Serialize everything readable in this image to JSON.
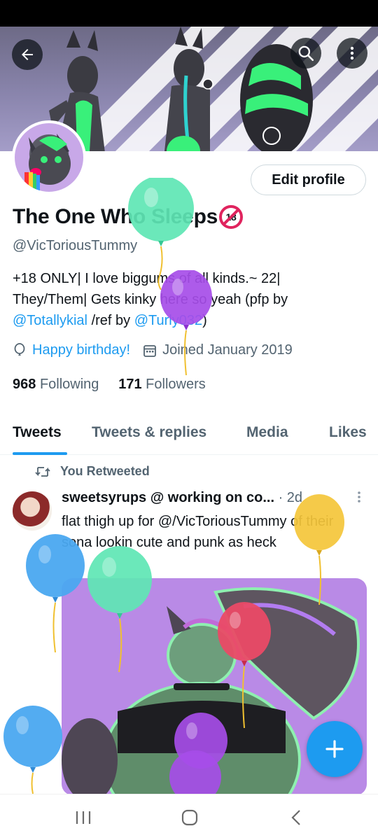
{
  "profile": {
    "display_name": "The One Who Sleeps",
    "age_badge": "18",
    "handle": "@VicToriousTummy",
    "bio_line1": "+18 ONLY| I love biggums of all kinds.~ 22|",
    "bio_line2": "They/Them| Gets kinky here so yeah (pfp by",
    "bio_mention1": "@Totallykial",
    "bio_mid": " /ref by ",
    "bio_mention2": "@Turly032",
    "bio_end": ")",
    "birthday": "Happy birthday!",
    "joined": "Joined January 2019",
    "following_count": "968",
    "following_label": "Following",
    "followers_count": "171",
    "followers_label": "Followers",
    "edit_label": "Edit profile"
  },
  "tabs": [
    "Tweets",
    "Tweets & replies",
    "Media",
    "Likes"
  ],
  "tweet": {
    "retweet_label": "You Retweeted",
    "author": "sweetsyrups @ working on co...",
    "time": "· 2d",
    "text": "flat thigh up for @/VicToriousTummy of their sona lookin cute and punk as heck"
  },
  "colors": {
    "accent": "#1d9bf0",
    "badge_red": "#e0245e",
    "balloon_teal": "#5ee6b4",
    "balloon_purple": "#a64de8",
    "balloon_blue": "#4aa8f0",
    "balloon_yellow": "#f4c63a",
    "balloon_red": "#ea4a66"
  }
}
